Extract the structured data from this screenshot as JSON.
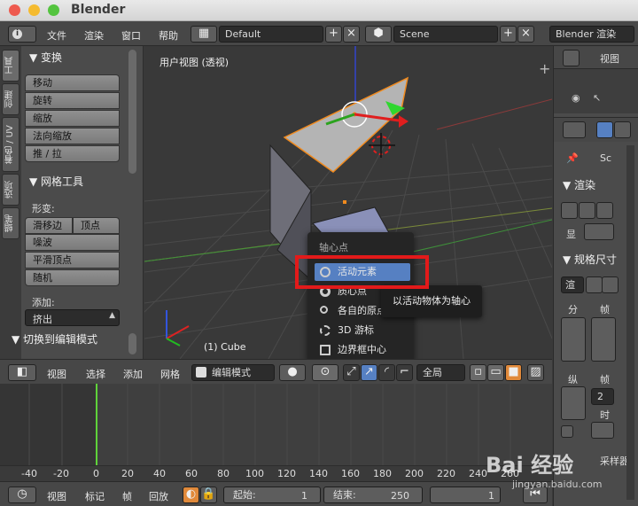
{
  "window": {
    "title": "Blender"
  },
  "menubar": {
    "items": [
      "文件",
      "渲染",
      "窗口",
      "帮助"
    ],
    "screen_layout": "Default",
    "scene": "Scene",
    "render_engine": "Blender 渲染"
  },
  "toolshelf": {
    "tabs": [
      "工具",
      "创建",
      "着色 / UV",
      "选项",
      "蜡笔"
    ],
    "transform_panel": "▼ 变换",
    "transform_buttons": [
      "移动",
      "旋转",
      "缩放",
      "法向缩放",
      "推 / 拉"
    ],
    "mesh_panel": "▼ 网格工具",
    "deform_label": "形变:",
    "slide_edge": "滑移边",
    "slide_vertex": "顶点",
    "deform_buttons": [
      "噪波",
      "平滑顶点",
      "随机"
    ],
    "add_label": "添加:",
    "extrude": "挤出",
    "toggle_editmode": "▼ 切换到编辑模式"
  },
  "viewport": {
    "view_label": "用户视图 (透视)",
    "object_label": "(1) Cube"
  },
  "pivot_menu": {
    "title": "轴心点",
    "items": [
      "活动元素",
      "质心点",
      "各自的原点",
      "3D 游标",
      "边界框中心"
    ],
    "selected": "活动元素"
  },
  "tooltip": "以活动物体为轴心",
  "v3d_header": {
    "menus": [
      "视图",
      "选择",
      "添加",
      "网格"
    ],
    "mode": "编辑模式",
    "orientation": "全局"
  },
  "timeline": {
    "ticks": [
      "-40",
      "-20",
      "0",
      "20",
      "40",
      "60",
      "80",
      "100",
      "120",
      "140",
      "160",
      "180",
      "200",
      "220",
      "240",
      "260"
    ],
    "header": [
      "视图",
      "标记",
      "帧",
      "回放"
    ],
    "start_label": "起始:",
    "start_value": "1",
    "end_label": "结束:",
    "end_value": "250",
    "current_frame": "1"
  },
  "outliner": {
    "view": "视图"
  },
  "properties": {
    "scene_short": "Sc",
    "render_panel": "▼ 渲染",
    "display_label": "显",
    "dimensions_panel": "▼ 规格尺寸",
    "render_preset": "渲",
    "res_label": "分",
    "frame_label": "帧",
    "aspect_label": "纵",
    "frame_rate_label": "帧",
    "frame_rate_value": "2",
    "time_label": "时",
    "sampling_label": "采样器"
  },
  "watermark": {
    "text": "Bai 经验",
    "sub": "jingyan.baidu.com"
  },
  "colors": {
    "accent": "#5680c2",
    "highlight_box": "#e21a1a",
    "timeline_cursor": "#5fd33a"
  }
}
